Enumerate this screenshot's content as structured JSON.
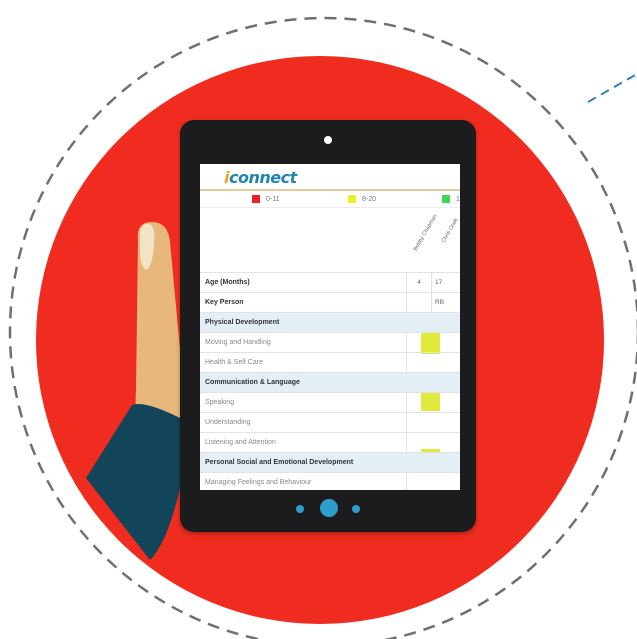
{
  "app": {
    "logo_i": "i",
    "logo_rest": "connect"
  },
  "legend": [
    {
      "label": "0-11",
      "color": "#ee2020"
    },
    {
      "label": "8-20",
      "color": "#eeee2a"
    },
    {
      "label": "1",
      "color": "#40d655"
    }
  ],
  "children": [
    "Bobby Chapman",
    "Chris Cook"
  ],
  "rows": [
    {
      "label": "Age (Months)",
      "type": "bold",
      "c1": "4",
      "c2": "17"
    },
    {
      "label": "Key Person",
      "type": "bold",
      "c1": "",
      "c2": "RB"
    },
    {
      "label": "Physical Development",
      "type": "section",
      "c1": "",
      "c2": ""
    },
    {
      "label": "Moving and Handling",
      "type": "item",
      "c1": "",
      "c2": ""
    },
    {
      "label": "Health & Self Care",
      "type": "item",
      "c1": "",
      "c2": ""
    },
    {
      "label": "Communication & Language",
      "type": "section",
      "c1": "",
      "c2": ""
    },
    {
      "label": "Speaking",
      "type": "item",
      "c1": "",
      "c2": ""
    },
    {
      "label": "Understanding",
      "type": "item",
      "c1": "",
      "c2": ""
    },
    {
      "label": "Listening and Attention",
      "type": "item",
      "c1": "",
      "c2": ""
    },
    {
      "label": "Personal Social and Emotional Development",
      "type": "section",
      "c1": "",
      "c2": ""
    },
    {
      "label": "Managing Feelings and Behaviour",
      "type": "item",
      "c1": "",
      "c2": ""
    },
    {
      "label": "",
      "type": "item",
      "c1": "",
      "c2": ""
    }
  ],
  "colors": {
    "accent_red": "#f02b1f",
    "tablet": "#1c1c1e",
    "button_blue": "#2e9dc9",
    "highlight": "#dfea3a",
    "sleeve": "#12445a"
  }
}
